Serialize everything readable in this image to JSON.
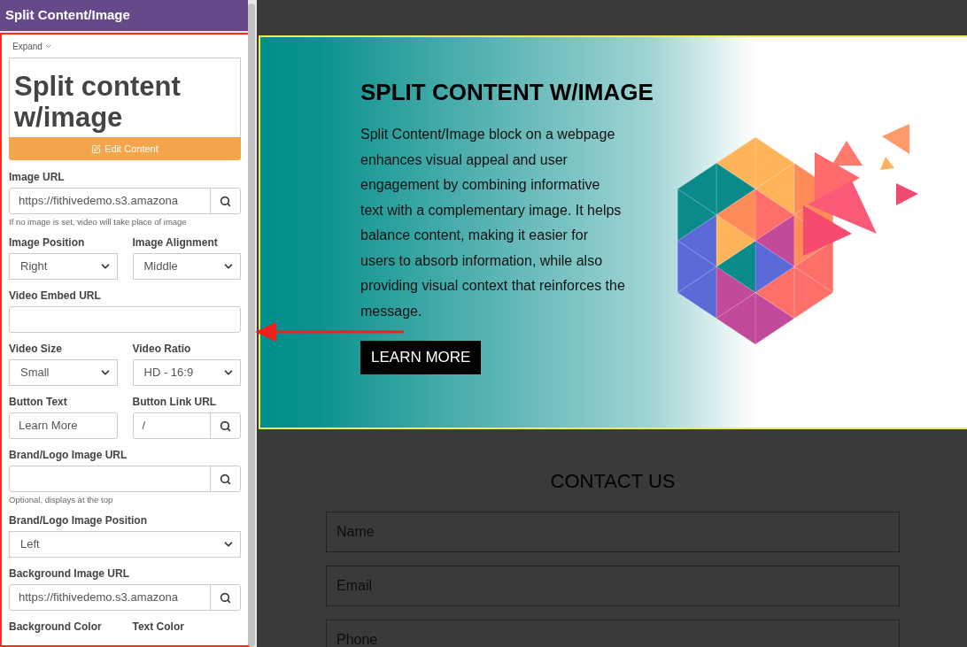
{
  "sidebar": {
    "title": "Split Content/Image",
    "expand": "Expand",
    "preview_heading": "Split content w/image",
    "edit_button": "Edit Content",
    "rows": [
      {
        "fields": [
          {
            "kind": "search",
            "label": "Image URL",
            "value": "https://fithivedemo.s3.amazona"
          }
        ],
        "help": "If no image is set, video will take place of image"
      },
      {
        "fields": [
          {
            "kind": "select",
            "label": "Image Position",
            "value": "Right"
          },
          {
            "kind": "select",
            "label": "Image Alignment",
            "value": "Middle"
          }
        ]
      },
      {
        "fields": [
          {
            "kind": "text",
            "label": "Video Embed URL"
          }
        ]
      },
      {
        "fields": [
          {
            "kind": "select",
            "label": "Video Size",
            "value": "Small"
          },
          {
            "kind": "select",
            "label": "Video Ratio",
            "value": "HD - 16:9"
          }
        ]
      },
      {
        "fields": [
          {
            "kind": "text",
            "label": "Button Text",
            "value": "Learn More"
          },
          {
            "kind": "search",
            "label": "Button Link URL",
            "value": "/"
          }
        ]
      },
      {
        "fields": [
          {
            "kind": "search",
            "label": "Brand/Logo Image URL"
          }
        ],
        "help": "Optional, displays at the top"
      },
      {
        "fields": [
          {
            "kind": "select",
            "label": "Brand/Logo Image Position",
            "value": "Left"
          }
        ]
      },
      {
        "fields": [
          {
            "kind": "search",
            "label": "Background Image URL",
            "value": "https://fithivedemo.s3.amazona"
          }
        ]
      },
      {
        "fields": [
          {
            "kind": "label",
            "label": "Background Color"
          },
          {
            "kind": "label",
            "label": "Text Color"
          }
        ]
      }
    ]
  },
  "hero": {
    "title": "SPLIT CONTENT W/IMAGE",
    "body": "Split Content/Image block on a webpage enhances visual appeal and user engagement by combining informative text with a complementary image. It helps balance content, making it easier for users to absorb information, while also providing visual context that reinforces the message.",
    "button": "LEARN MORE"
  },
  "contact": {
    "title": "CONTACT US",
    "fields": [
      {
        "placeholder": "Name"
      },
      {
        "placeholder": "Email"
      },
      {
        "placeholder": "Phone"
      }
    ]
  }
}
